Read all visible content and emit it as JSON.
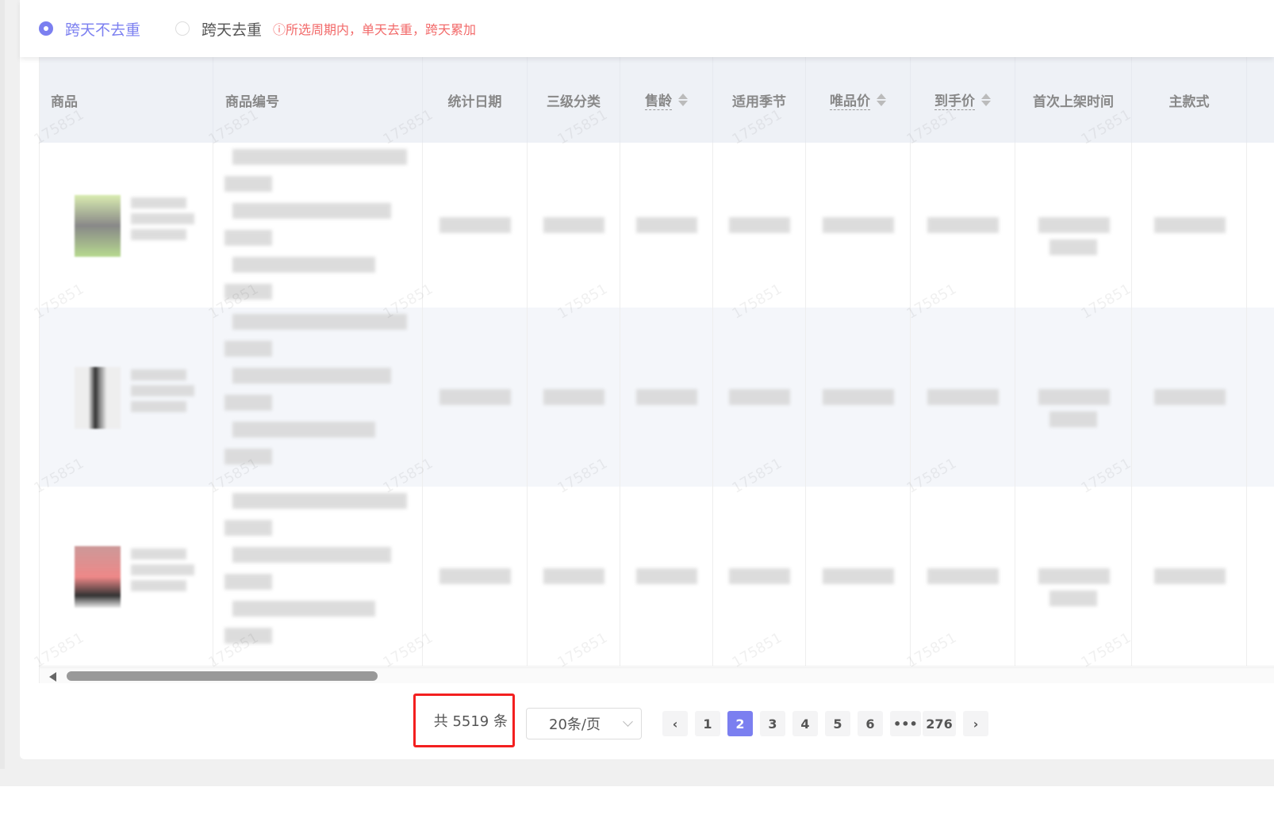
{
  "filter": {
    "options": [
      {
        "label": "跨天不去重",
        "selected": true
      },
      {
        "label": "跨天去重",
        "selected": false
      }
    ],
    "hint": "ⓘ所选周期内，单天去重，跨天累加"
  },
  "table": {
    "columns": [
      {
        "label": "商品",
        "sortable": false
      },
      {
        "label": "商品编号",
        "sortable": false
      },
      {
        "label": "统计日期",
        "sortable": false
      },
      {
        "label": "三级分类",
        "sortable": false
      },
      {
        "label": "售龄",
        "sortable": true
      },
      {
        "label": "适用季节",
        "sortable": false
      },
      {
        "label": "唯品价",
        "sortable": true
      },
      {
        "label": "到手价",
        "sortable": true
      },
      {
        "label": "首次上架时间",
        "sortable": false
      },
      {
        "label": "主款式",
        "sortable": false
      }
    ],
    "watermark": "175851"
  },
  "pagination": {
    "total": "共 5519 条",
    "page_size": "20条/页",
    "prev": "‹",
    "next": "›",
    "pages": [
      "1",
      "2",
      "3",
      "4",
      "5",
      "6",
      "•••",
      "276"
    ],
    "current": "2"
  }
}
